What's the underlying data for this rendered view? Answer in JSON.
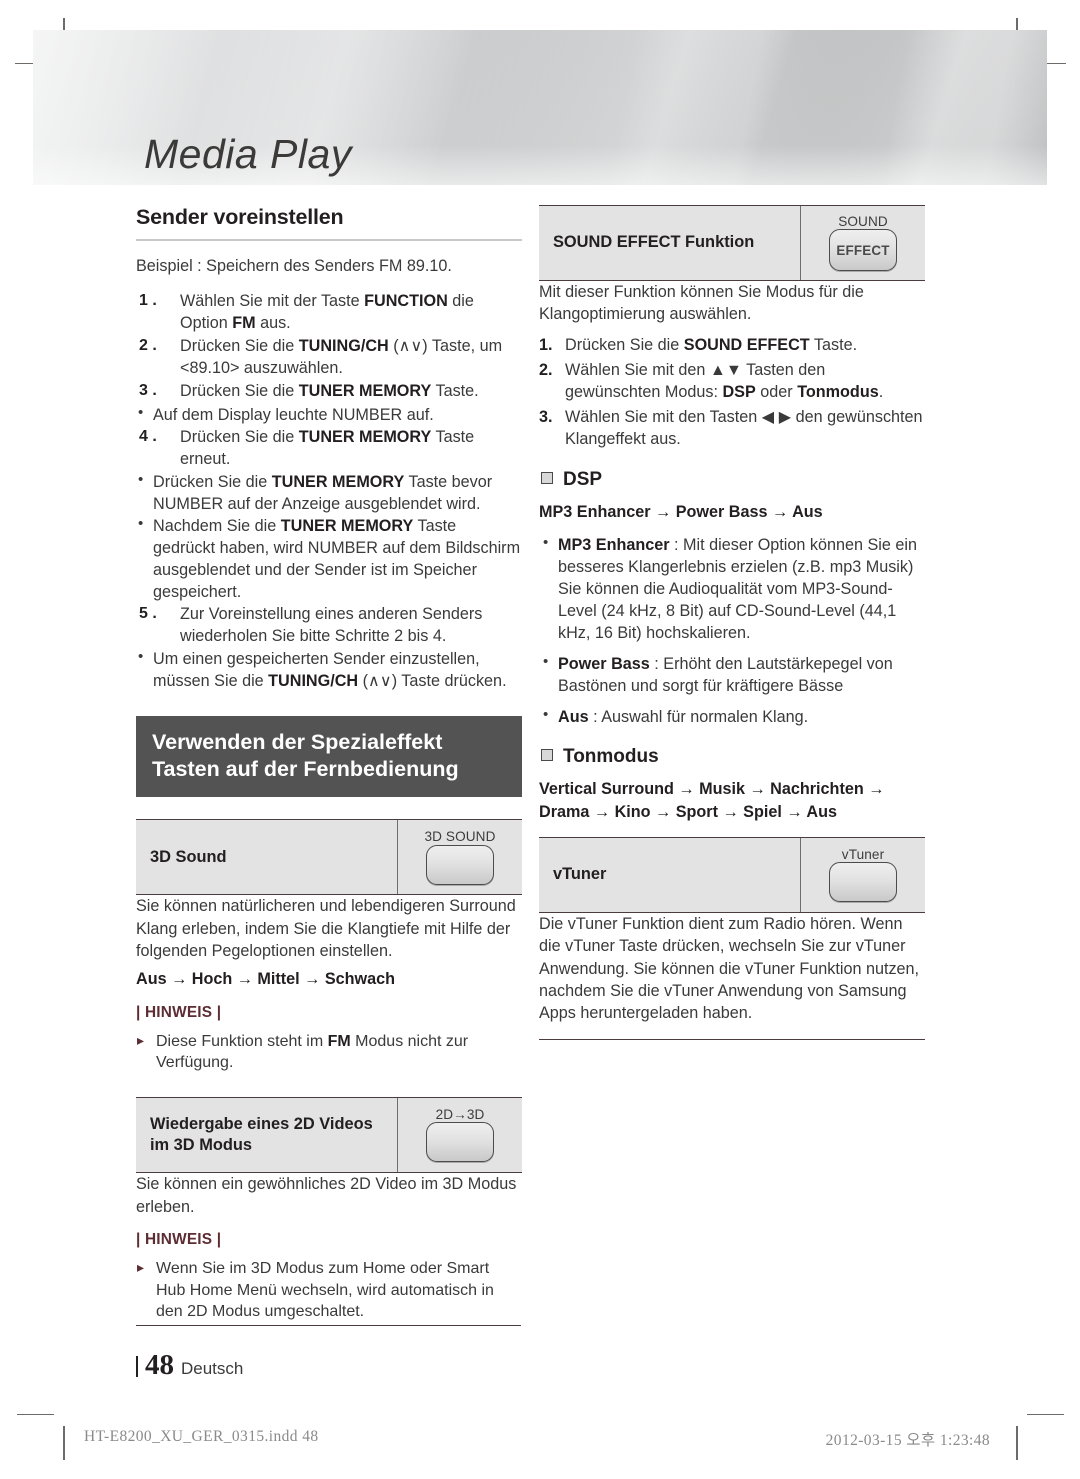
{
  "header": {
    "chapter_title": "Media Play"
  },
  "left": {
    "section_title": "Sender voreinstellen",
    "intro": "Beispiel : Speichern des Senders FM 89.10.",
    "steps": [
      {
        "num": "1 .",
        "html": "Wählen Sie mit der Taste <b>FUNCTION</b> die Option <b>FM</b> aus."
      },
      {
        "num": "2 .",
        "html": "Drücken Sie die <b>TUNING/CH</b> (∧∨) Taste, um &lt;89.10&gt; auswählen."
      },
      {
        "num": "3 .",
        "html": "Drücken Sie die <b>TUNER MEMORY</b> Taste."
      },
      {
        "num": "4 .",
        "html": "Drücken Sie die <b>TUNER MEMORY</b> Taste erneut."
      },
      {
        "num": "5 .",
        "html": "Zur Voreinstellung eines anderen Senders wiederholen Sie bitte Schritte 2 bis 4."
      }
    ],
    "step2_text": "Drücken Sie die TUNING/CH (∧∨) Taste, um <89.10> auszuwählen.",
    "bullet_after_3": "Auf dem Display leuchte NUMBER auf.",
    "bullets_after_4": [
      "Drücken Sie die TUNER MEMORY Taste bevor NUMBER auf der Anzeige ausgeblendet wird.",
      "Nachdem Sie die TUNER MEMORY Taste gedrückt haben, wird NUMBER auf dem Bildschirm ausgeblendet und der Sender ist im Speicher gespeichert."
    ],
    "bullet_after_5": "Um einen gespeicherten Sender einzustellen, müssen Sie die TUNING/CH (∧∨) Taste drücken.",
    "dark_heading": "Verwenden der Spezialeffekt Tasten auf der Fernbedienung",
    "feature_3d": {
      "label": "3D Sound",
      "button_caption": "3D SOUND",
      "button_text": ""
    },
    "feature_3d_body": "Sie können natürlicheren und lebendigeren Surround Klang erleben, indem Sie die Klangtiefe mit Hilfe der folgenden Pegeloptionen einstellen.",
    "feature_3d_chain": "Aus → Hoch → Mittel → Schwach",
    "hinweis_label": "| HINWEIS |",
    "feature_3d_note": "Diese Funktion steht im FM Modus nicht zur Verfügung.",
    "feature_2d3d": {
      "label": "Wiedergabe eines 2D Videos im 3D Modus",
      "button_caption": "2D→3D",
      "button_text": ""
    },
    "feature_2d3d_body": "Sie können ein gewöhnliches 2D Video im 3D Modus erleben.",
    "feature_2d3d_note": "Wenn Sie im 3D Modus zum Home oder Smart Hub Home Menü wechseln, wird automatisch in den 2D Modus umgeschaltet."
  },
  "right": {
    "feature_sound_effect": {
      "label": "SOUND EFFECT Funktion",
      "button_caption": "SOUND",
      "button_text": "EFFECT"
    },
    "sound_effect_body": "Mit dieser Funktion können Sie Modus für die Klangoptimierung auswählen.",
    "sound_effect_steps": [
      {
        "num": "1.",
        "html": "Drücken Sie die <b>SOUND EFFECT</b> Taste."
      },
      {
        "num": "2.",
        "html": "Wählen Sie mit den ▲▼ Tasten den gewünschten Modus: <b>DSP</b> oder <b>Tonmodus</b>."
      },
      {
        "num": "3.",
        "html": "Wählen Sie mit den Tasten ◀▶ den gewünschten Klangeffekt aus."
      }
    ],
    "dsp_heading": "DSP",
    "dsp_chain": "MP3 Enhancer → Power Bass → Aus",
    "dsp_items": [
      {
        "term": "MP3 Enhancer",
        "text": " : Mit dieser Option können Sie ein besseres Klangerlebnis erzielen (z.B. mp3 Musik) Sie können die Audioqualität vom MP3-Sound-Level (24 kHz, 8 Bit) auf CD-Sound-Level (44,1 kHz, 16 Bit) hochskalieren."
      },
      {
        "term": "Power Bass",
        "text": " : Erhöht den Lautstärkepegel von Bastönen und sorgt für kräftigere Bässe"
      },
      {
        "term": "Aus",
        "text": " : Auswahl für normalen Klang."
      }
    ],
    "tonmodus_heading": "Tonmodus",
    "tonmodus_chain": "Vertical Surround → Musik → Nachrichten → Drama → Kino → Sport → Spiel → Aus",
    "feature_vtuner": {
      "label": "vTuner",
      "button_caption": "vTuner",
      "button_text": ""
    },
    "vtuner_body": "Die vTuner Funktion dient zum Radio hören. Wenn die vTuner Taste drücken, wechseln Sie zur vTuner Anwendung. Sie können die vTuner Funktion nutzen, nachdem Sie die vTuner Anwendung von Samsung Apps heruntergeladen haben."
  },
  "footer": {
    "page_number": "48",
    "language": "Deutsch",
    "print_file": "HT-E8200_XU_GER_0315.indd   48",
    "print_timestamp": "2012-03-15   오후 1:23:48"
  }
}
